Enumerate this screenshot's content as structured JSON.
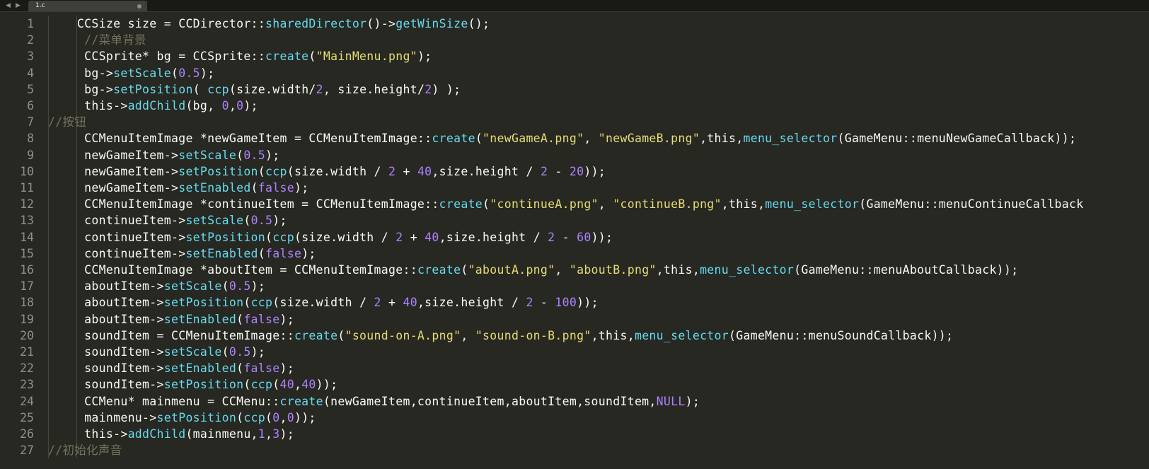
{
  "tabbar": {
    "nav_back": "◀",
    "nav_forward": "▶",
    "tab_label": "1.c"
  },
  "editor": {
    "line_numbers": [
      "1",
      "2",
      "3",
      "4",
      "5",
      "6",
      "7",
      "8",
      "9",
      "10",
      "11",
      "12",
      "13",
      "14",
      "15",
      "16",
      "17",
      "18",
      "19",
      "20",
      "21",
      "22",
      "23",
      "24",
      "25",
      "26",
      "27"
    ],
    "lines": [
      [
        {
          "t": "    CCSize size = CCDirector::",
          "c": ""
        },
        {
          "t": "sharedDirector",
          "c": "fn"
        },
        {
          "t": "()->",
          "c": ""
        },
        {
          "t": "getWinSize",
          "c": "fn"
        },
        {
          "t": "();",
          "c": ""
        }
      ],
      [
        {
          "t": "     //菜单背景",
          "c": "com"
        }
      ],
      [
        {
          "t": "     CCSprite* bg = CCSprite::",
          "c": ""
        },
        {
          "t": "create",
          "c": "fn"
        },
        {
          "t": "(",
          "c": ""
        },
        {
          "t": "\"MainMenu.png\"",
          "c": "str"
        },
        {
          "t": ");",
          "c": ""
        }
      ],
      [
        {
          "t": "     bg->",
          "c": ""
        },
        {
          "t": "setScale",
          "c": "fn"
        },
        {
          "t": "(",
          "c": ""
        },
        {
          "t": "0.5",
          "c": "num"
        },
        {
          "t": ");",
          "c": ""
        }
      ],
      [
        {
          "t": "     bg->",
          "c": ""
        },
        {
          "t": "setPosition",
          "c": "fn"
        },
        {
          "t": "( ",
          "c": ""
        },
        {
          "t": "ccp",
          "c": "fn"
        },
        {
          "t": "(size.width/",
          "c": ""
        },
        {
          "t": "2",
          "c": "num"
        },
        {
          "t": ", size.height/",
          "c": ""
        },
        {
          "t": "2",
          "c": "num"
        },
        {
          "t": ") );",
          "c": ""
        }
      ],
      [
        {
          "t": "     this->",
          "c": ""
        },
        {
          "t": "addChild",
          "c": "fn"
        },
        {
          "t": "(bg, ",
          "c": ""
        },
        {
          "t": "0",
          "c": "num"
        },
        {
          "t": ",",
          "c": ""
        },
        {
          "t": "0",
          "c": "num"
        },
        {
          "t": ");",
          "c": ""
        }
      ],
      [
        {
          "t": "//按钮",
          "c": "com"
        }
      ],
      [
        {
          "t": "     CCMenuItemImage *newGameItem = CCMenuItemImage::",
          "c": ""
        },
        {
          "t": "create",
          "c": "fn"
        },
        {
          "t": "(",
          "c": ""
        },
        {
          "t": "\"newGameA.png\"",
          "c": "str"
        },
        {
          "t": ", ",
          "c": ""
        },
        {
          "t": "\"newGameB.png\"",
          "c": "str"
        },
        {
          "t": ",this,",
          "c": ""
        },
        {
          "t": "menu_selector",
          "c": "fn"
        },
        {
          "t": "(GameMenu::menuNewGameCallback));",
          "c": ""
        }
      ],
      [
        {
          "t": "     newGameItem->",
          "c": ""
        },
        {
          "t": "setScale",
          "c": "fn"
        },
        {
          "t": "(",
          "c": ""
        },
        {
          "t": "0.5",
          "c": "num"
        },
        {
          "t": ");",
          "c": ""
        }
      ],
      [
        {
          "t": "     newGameItem->",
          "c": ""
        },
        {
          "t": "setPosition",
          "c": "fn"
        },
        {
          "t": "(",
          "c": ""
        },
        {
          "t": "ccp",
          "c": "fn"
        },
        {
          "t": "(size.width / ",
          "c": ""
        },
        {
          "t": "2",
          "c": "num"
        },
        {
          "t": " + ",
          "c": ""
        },
        {
          "t": "40",
          "c": "num"
        },
        {
          "t": ",size.height / ",
          "c": ""
        },
        {
          "t": "2",
          "c": "num"
        },
        {
          "t": " - ",
          "c": ""
        },
        {
          "t": "20",
          "c": "num"
        },
        {
          "t": "));",
          "c": ""
        }
      ],
      [
        {
          "t": "     newGameItem->",
          "c": ""
        },
        {
          "t": "setEnabled",
          "c": "fn"
        },
        {
          "t": "(",
          "c": ""
        },
        {
          "t": "false",
          "c": "kw"
        },
        {
          "t": ");",
          "c": ""
        }
      ],
      [
        {
          "t": "     CCMenuItemImage *continueItem = CCMenuItemImage::",
          "c": ""
        },
        {
          "t": "create",
          "c": "fn"
        },
        {
          "t": "(",
          "c": ""
        },
        {
          "t": "\"continueA.png\"",
          "c": "str"
        },
        {
          "t": ", ",
          "c": ""
        },
        {
          "t": "\"continueB.png\"",
          "c": "str"
        },
        {
          "t": ",this,",
          "c": ""
        },
        {
          "t": "menu_selector",
          "c": "fn"
        },
        {
          "t": "(GameMenu::menuContinueCallback",
          "c": ""
        }
      ],
      [
        {
          "t": "     continueItem->",
          "c": ""
        },
        {
          "t": "setScale",
          "c": "fn"
        },
        {
          "t": "(",
          "c": ""
        },
        {
          "t": "0.5",
          "c": "num"
        },
        {
          "t": ");",
          "c": ""
        }
      ],
      [
        {
          "t": "     continueItem->",
          "c": ""
        },
        {
          "t": "setPosition",
          "c": "fn"
        },
        {
          "t": "(",
          "c": ""
        },
        {
          "t": "ccp",
          "c": "fn"
        },
        {
          "t": "(size.width / ",
          "c": ""
        },
        {
          "t": "2",
          "c": "num"
        },
        {
          "t": " + ",
          "c": ""
        },
        {
          "t": "40",
          "c": "num"
        },
        {
          "t": ",size.height / ",
          "c": ""
        },
        {
          "t": "2",
          "c": "num"
        },
        {
          "t": " - ",
          "c": ""
        },
        {
          "t": "60",
          "c": "num"
        },
        {
          "t": "));",
          "c": ""
        }
      ],
      [
        {
          "t": "     continueItem->",
          "c": ""
        },
        {
          "t": "setEnabled",
          "c": "fn"
        },
        {
          "t": "(",
          "c": ""
        },
        {
          "t": "false",
          "c": "kw"
        },
        {
          "t": ");",
          "c": ""
        }
      ],
      [
        {
          "t": "     CCMenuItemImage *aboutItem = CCMenuItemImage::",
          "c": ""
        },
        {
          "t": "create",
          "c": "fn"
        },
        {
          "t": "(",
          "c": ""
        },
        {
          "t": "\"aboutA.png\"",
          "c": "str"
        },
        {
          "t": ", ",
          "c": ""
        },
        {
          "t": "\"aboutB.png\"",
          "c": "str"
        },
        {
          "t": ",this,",
          "c": ""
        },
        {
          "t": "menu_selector",
          "c": "fn"
        },
        {
          "t": "(GameMenu::menuAboutCallback));",
          "c": ""
        }
      ],
      [
        {
          "t": "     aboutItem->",
          "c": ""
        },
        {
          "t": "setScale",
          "c": "fn"
        },
        {
          "t": "(",
          "c": ""
        },
        {
          "t": "0.5",
          "c": "num"
        },
        {
          "t": ");",
          "c": ""
        }
      ],
      [
        {
          "t": "     aboutItem->",
          "c": ""
        },
        {
          "t": "setPosition",
          "c": "fn"
        },
        {
          "t": "(",
          "c": ""
        },
        {
          "t": "ccp",
          "c": "fn"
        },
        {
          "t": "(size.width / ",
          "c": ""
        },
        {
          "t": "2",
          "c": "num"
        },
        {
          "t": " + ",
          "c": ""
        },
        {
          "t": "40",
          "c": "num"
        },
        {
          "t": ",size.height / ",
          "c": ""
        },
        {
          "t": "2",
          "c": "num"
        },
        {
          "t": " - ",
          "c": ""
        },
        {
          "t": "100",
          "c": "num"
        },
        {
          "t": "));",
          "c": ""
        }
      ],
      [
        {
          "t": "     aboutItem->",
          "c": ""
        },
        {
          "t": "setEnabled",
          "c": "fn"
        },
        {
          "t": "(",
          "c": ""
        },
        {
          "t": "false",
          "c": "kw"
        },
        {
          "t": ");",
          "c": ""
        }
      ],
      [
        {
          "t": "     soundItem = CCMenuItemImage::",
          "c": ""
        },
        {
          "t": "create",
          "c": "fn"
        },
        {
          "t": "(",
          "c": ""
        },
        {
          "t": "\"sound-on-A.png\"",
          "c": "str"
        },
        {
          "t": ", ",
          "c": ""
        },
        {
          "t": "\"sound-on-B.png\"",
          "c": "str"
        },
        {
          "t": ",this,",
          "c": ""
        },
        {
          "t": "menu_selector",
          "c": "fn"
        },
        {
          "t": "(GameMenu::menuSoundCallback));",
          "c": ""
        }
      ],
      [
        {
          "t": "     soundItem->",
          "c": ""
        },
        {
          "t": "setScale",
          "c": "fn"
        },
        {
          "t": "(",
          "c": ""
        },
        {
          "t": "0.5",
          "c": "num"
        },
        {
          "t": ");",
          "c": ""
        }
      ],
      [
        {
          "t": "     soundItem->",
          "c": ""
        },
        {
          "t": "setEnabled",
          "c": "fn"
        },
        {
          "t": "(",
          "c": ""
        },
        {
          "t": "false",
          "c": "kw"
        },
        {
          "t": ");",
          "c": ""
        }
      ],
      [
        {
          "t": "     soundItem->",
          "c": ""
        },
        {
          "t": "setPosition",
          "c": "fn"
        },
        {
          "t": "(",
          "c": ""
        },
        {
          "t": "ccp",
          "c": "fn"
        },
        {
          "t": "(",
          "c": ""
        },
        {
          "t": "40",
          "c": "num"
        },
        {
          "t": ",",
          "c": ""
        },
        {
          "t": "40",
          "c": "num"
        },
        {
          "t": "));",
          "c": ""
        }
      ],
      [
        {
          "t": "     CCMenu* mainmenu = CCMenu::",
          "c": ""
        },
        {
          "t": "create",
          "c": "fn"
        },
        {
          "t": "(newGameItem,continueItem,aboutItem,soundItem,",
          "c": ""
        },
        {
          "t": "NULL",
          "c": "kw"
        },
        {
          "t": ");",
          "c": ""
        }
      ],
      [
        {
          "t": "     mainmenu->",
          "c": ""
        },
        {
          "t": "setPosition",
          "c": "fn"
        },
        {
          "t": "(",
          "c": ""
        },
        {
          "t": "ccp",
          "c": "fn"
        },
        {
          "t": "(",
          "c": ""
        },
        {
          "t": "0",
          "c": "num"
        },
        {
          "t": ",",
          "c": ""
        },
        {
          "t": "0",
          "c": "num"
        },
        {
          "t": "));",
          "c": ""
        }
      ],
      [
        {
          "t": "     this->",
          "c": ""
        },
        {
          "t": "addChild",
          "c": "fn"
        },
        {
          "t": "(mainmenu,",
          "c": ""
        },
        {
          "t": "1",
          "c": "num"
        },
        {
          "t": ",",
          "c": ""
        },
        {
          "t": "3",
          "c": "num"
        },
        {
          "t": ");",
          "c": ""
        }
      ],
      [
        {
          "t": "//初始化声音",
          "c": "com"
        }
      ]
    ]
  },
  "colors": {
    "background": "#272822",
    "text": "#f8f8f2",
    "function": "#66d9ef",
    "string": "#e6db74",
    "number": "#ae81ff",
    "comment": "#75715e",
    "line_number": "#8f908a"
  }
}
